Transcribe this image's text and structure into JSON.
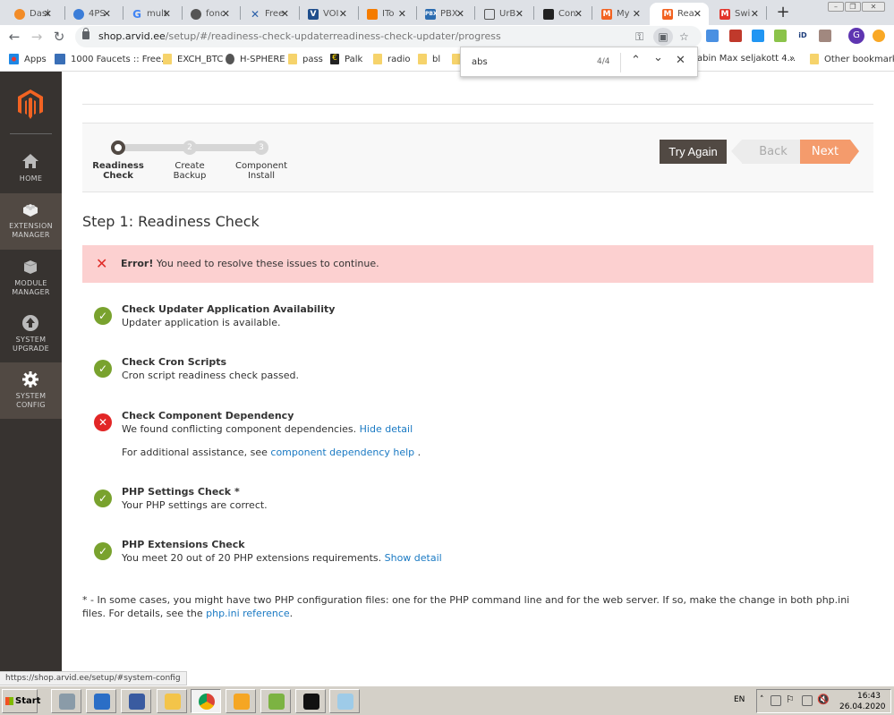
{
  "browser": {
    "tabs": [
      {
        "label": "Dasl",
        "icon": "dashboard-icon",
        "color": "#f28c28"
      },
      {
        "label": "4PS",
        "icon": "lock-app-icon",
        "color": "#3b7dd8"
      },
      {
        "label": "mult",
        "icon": "google-icon",
        "color": "#4285f4"
      },
      {
        "label": "fonc",
        "icon": "globe-icon",
        "color": "#555555"
      },
      {
        "label": "Free",
        "icon": "x-logo-icon",
        "color": "#2a5fa8"
      },
      {
        "label": "VOI",
        "icon": "v-logo-icon",
        "color": "#1f4e8c"
      },
      {
        "label": "ITo",
        "icon": "dots-logo-icon",
        "color": "#f57c00"
      },
      {
        "label": "PBX",
        "icon": "pbx-icon",
        "color": "#2b6cb0"
      },
      {
        "label": "UrB",
        "icon": "database-icon",
        "color": "#555555"
      },
      {
        "label": "Con",
        "icon": "page-icon",
        "color": "#222222"
      },
      {
        "label": "My",
        "icon": "magento-icon",
        "color": "#f26322"
      },
      {
        "label": "Rea",
        "icon": "magento-icon",
        "color": "#f26322",
        "active": true
      },
      {
        "label": "Swi",
        "icon": "magento-icon",
        "color": "#e2352b"
      }
    ],
    "new_tab": "+",
    "url_host": "shop.arvid.ee",
    "url_path": "/setup/#/readiness-check-updaterreadiness-check-updater/progress",
    "profile_initial": "G",
    "bookmarks": [
      {
        "label": "Apps",
        "icon": "apps-grid-icon"
      },
      {
        "label": "1000 Faucets :: Free...",
        "icon": "site-icon"
      },
      {
        "label": "EXCH_BTC",
        "icon": "folder-icon"
      },
      {
        "label": "H-SPHERE",
        "icon": "globe-icon"
      },
      {
        "label": "pass",
        "icon": "folder-icon"
      },
      {
        "label": "Palk",
        "icon": "euro-icon"
      },
      {
        "label": "radio",
        "icon": "folder-icon"
      },
      {
        "label": "bl",
        "icon": "folder-icon"
      },
      {
        "label": "abin Max seljakott 4...",
        "icon": "none"
      },
      {
        "label": "»",
        "icon": "none"
      },
      {
        "label": "Other bookmarks",
        "icon": "folder-icon"
      }
    ],
    "find": {
      "query": "abs",
      "count": "4/4"
    }
  },
  "sidebar": {
    "items": [
      {
        "label_1": "HOME",
        "label_2": "",
        "icon": "home-icon"
      },
      {
        "label_1": "EXTENSION",
        "label_2": "MANAGER",
        "icon": "lego-brick-icon",
        "active": true
      },
      {
        "label_1": "MODULE",
        "label_2": "MANAGER",
        "icon": "cube-icon"
      },
      {
        "label_1": "SYSTEM",
        "label_2": "UPGRADE",
        "icon": "upload-circle-icon"
      },
      {
        "label_1": "SYSTEM",
        "label_2": "CONFIG",
        "icon": "gear-icon",
        "active": true
      }
    ]
  },
  "wizard": {
    "steps": [
      {
        "number": "",
        "line1": "Readiness",
        "line2": "Check",
        "current": true
      },
      {
        "number": "2",
        "line1": "Create",
        "line2": "Backup"
      },
      {
        "number": "3",
        "line1": "Component",
        "line2": "Install"
      }
    ],
    "buttons": {
      "try_again": "Try Again",
      "back": "Back",
      "next": "Next"
    }
  },
  "page": {
    "title": "Step 1: Readiness Check",
    "error": {
      "strong": "Error!",
      "text": " You need to resolve these issues to continue."
    },
    "checks": [
      {
        "status": "ok",
        "title": "Check Updater Application Availability",
        "desc": "Updater application is available."
      },
      {
        "status": "ok",
        "title": "Check Cron Scripts",
        "desc": "Cron script readiness check passed."
      },
      {
        "status": "error",
        "title": "Check Component Dependency",
        "desc": "We found conflicting component dependencies. ",
        "link": "Hide detail",
        "extra_prefix": "For additional assistance, see ",
        "extra_link": "component dependency help",
        "extra_suffix": " ."
      },
      {
        "status": "ok",
        "title": "PHP Settings Check *",
        "desc": "Your PHP settings are correct."
      },
      {
        "status": "ok",
        "title": "PHP Extensions Check",
        "desc": "You meet 20 out of 20 PHP extensions requirements. ",
        "link": "Show detail"
      }
    ],
    "footnote_text": "* - In some cases, you might have two PHP configuration files: one for the PHP command line and for the web server. If so, make the change in both php.ini files. For details, see the ",
    "footnote_link": "php.ini reference",
    "footnote_end": "."
  },
  "status_url": "https://shop.arvid.ee/setup/#system-config",
  "taskbar": {
    "start": "Start",
    "apps": [
      "server-manager-icon",
      "powershell-icon",
      "remote-desktop-icon",
      "file-explorer-icon",
      "chrome-icon",
      "outlook-icon",
      "vmware-icon",
      "cmd-icon",
      "notepad-icon"
    ],
    "lang": "EN",
    "time": "16:43",
    "date": "26.04.2020"
  },
  "colors": {
    "magento_orange": "#f26322",
    "ok_green": "#79a22e",
    "error_red": "#e22626",
    "link_blue": "#1979c3",
    "next_orange": "#f49b6c",
    "sidebar_bg": "#373330"
  }
}
